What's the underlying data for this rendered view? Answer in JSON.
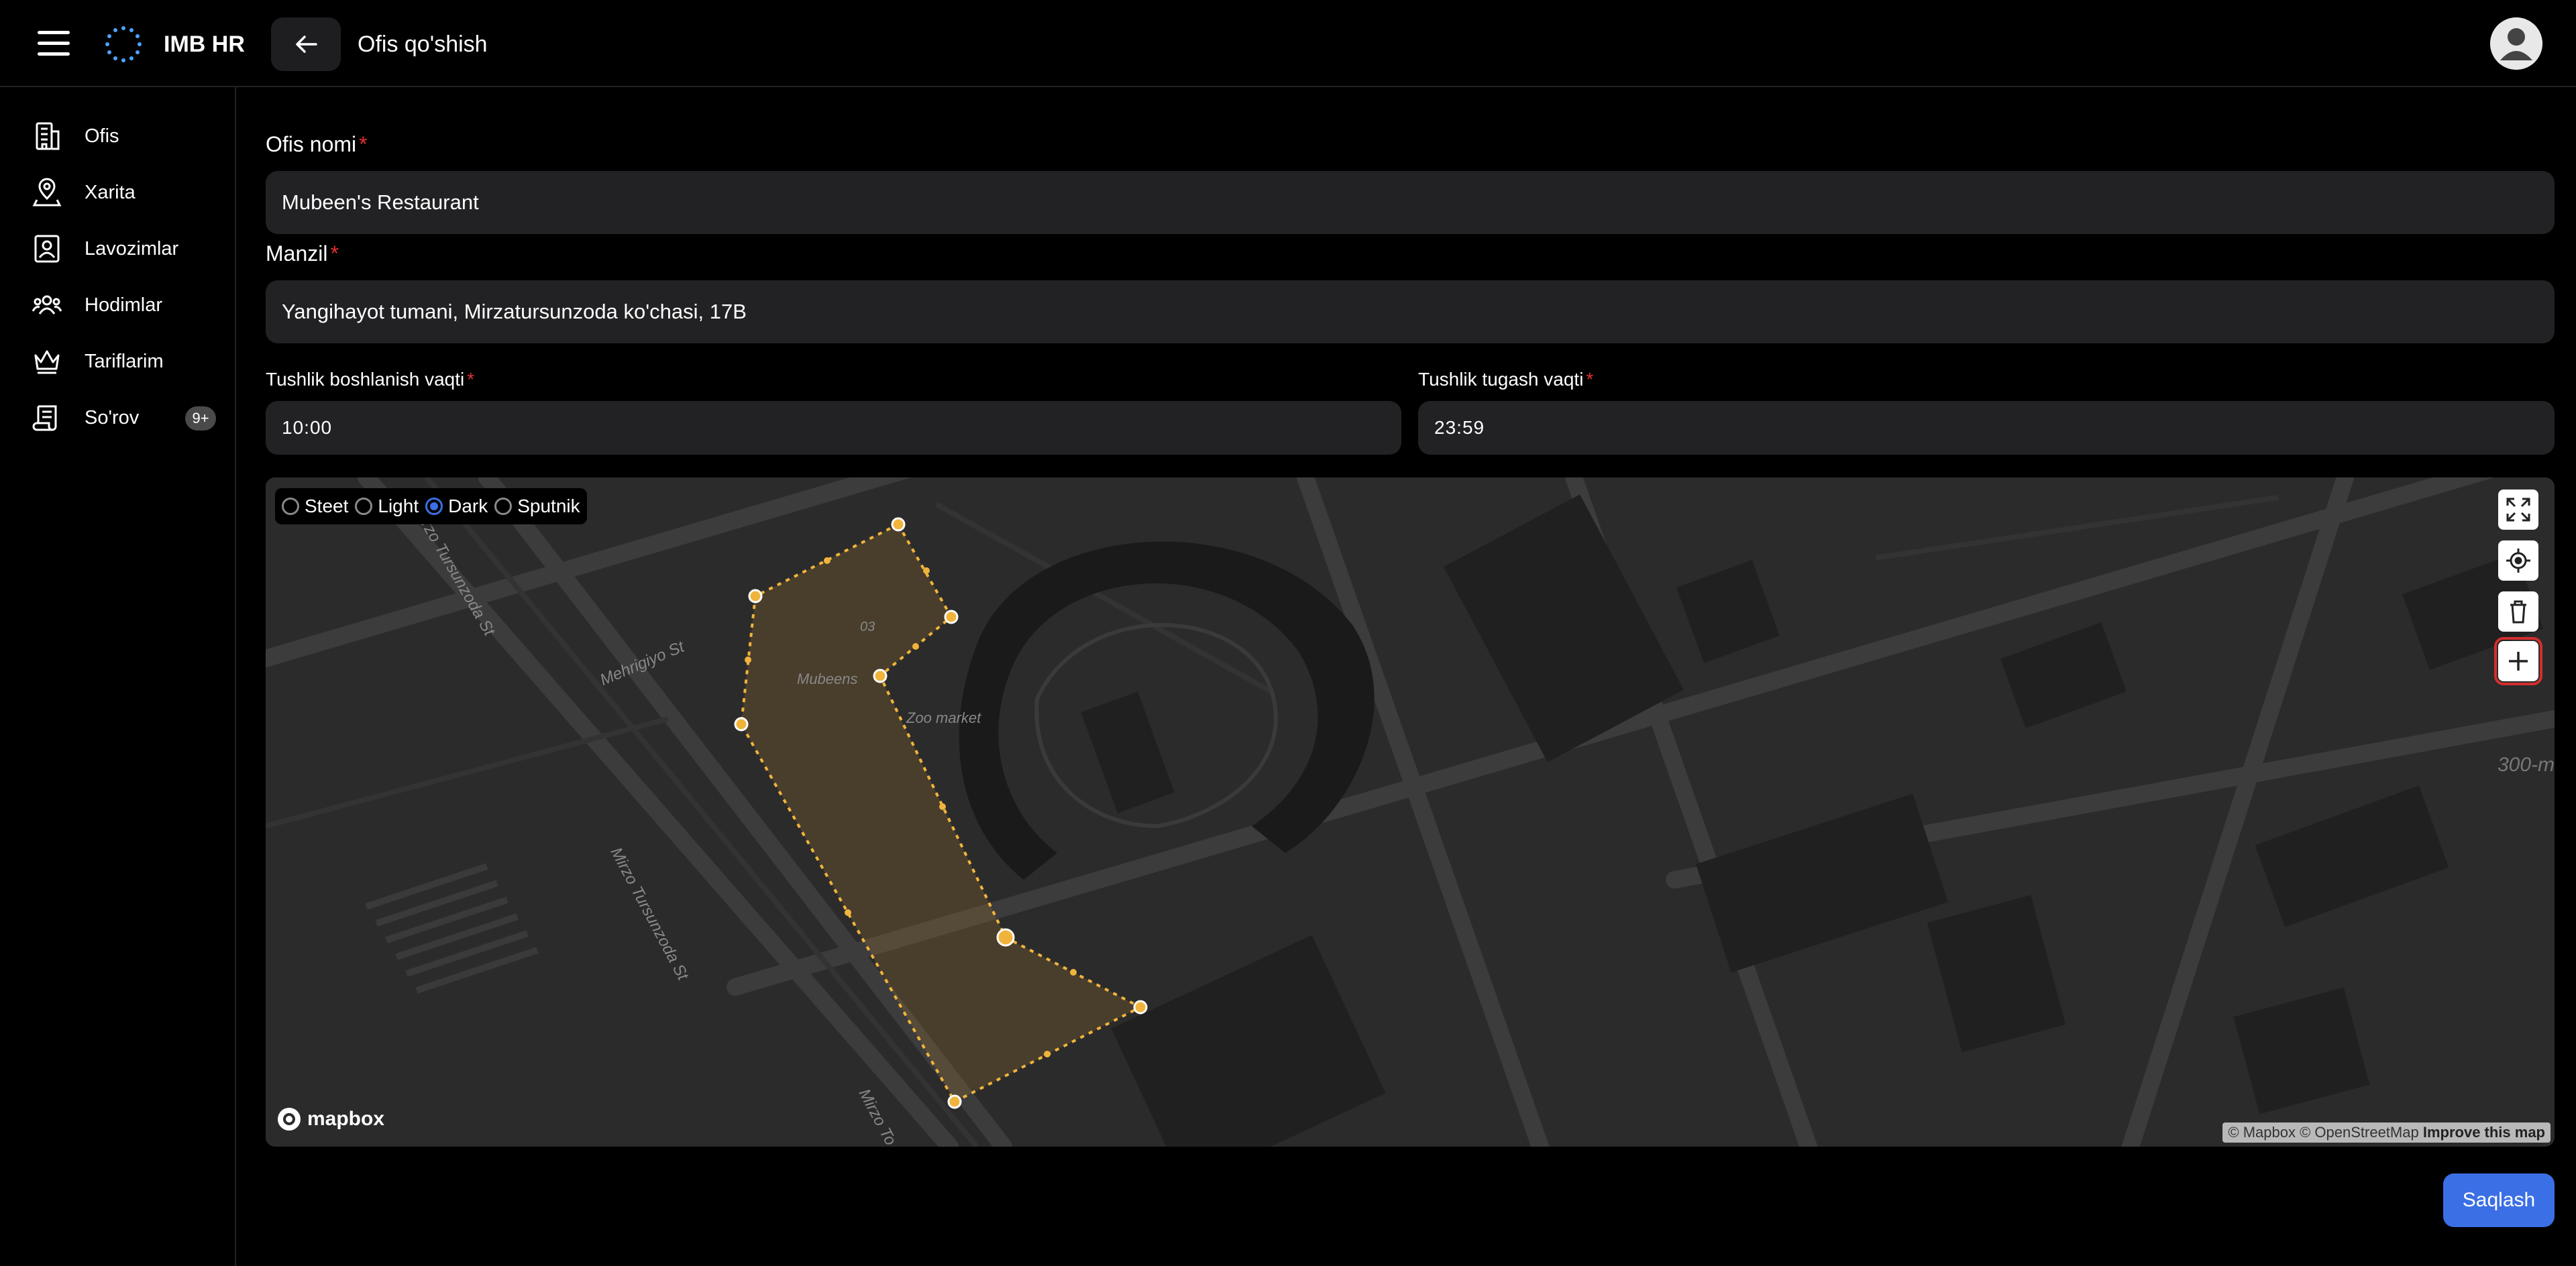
{
  "app": {
    "title": "IMB HR",
    "page_title": "Ofis qo'shish"
  },
  "sidebar": {
    "items": [
      {
        "label": "Ofis",
        "icon": "building-icon"
      },
      {
        "label": "Xarita",
        "icon": "map-pin-icon"
      },
      {
        "label": "Lavozimlar",
        "icon": "id-card-icon"
      },
      {
        "label": "Hodimlar",
        "icon": "users-icon"
      },
      {
        "label": "Tariflarim",
        "icon": "crown-icon"
      },
      {
        "label": "So'rov",
        "icon": "scroll-icon",
        "badge": "9+"
      }
    ]
  },
  "form": {
    "office_name_label": "Ofis nomi",
    "office_name_value": "Mubeen's Restaurant",
    "address_label": "Manzil",
    "address_value": "Yangihayot tumani, Mirzatursunzoda ko'chasi, 17B",
    "lunch_start_label": "Tushlik boshlanish vaqti",
    "lunch_start_hour": "10",
    "lunch_start_min": "00",
    "lunch_end_label": "Tushlik tugash vaqti",
    "lunch_end_hour": "23",
    "lunch_end_min": "59",
    "required_mark": "*",
    "time_sep": ":"
  },
  "map": {
    "styles": [
      {
        "label": "Steet",
        "selected": false
      },
      {
        "label": "Light",
        "selected": false
      },
      {
        "label": "Dark",
        "selected": true
      },
      {
        "label": "Sputnik",
        "selected": false
      }
    ],
    "labels": {
      "mehrigiyo": "Mehrigiyo St",
      "tursunzoda_top": "Mirzo Tursunzoda St",
      "mirzo_tursunzoda": "Mirzo Tursunzoda St",
      "mirzo_to": "Mirzo To",
      "mubeens": "Mubeens",
      "market": "Zoo market",
      "num_03": "03",
      "scale": "300-m"
    },
    "logo_text": "mapbox",
    "attribution": "© Mapbox © OpenStreetMap",
    "improve": "Improve this map",
    "polygon_color": "#f0b43c"
  },
  "actions": {
    "save": "Saqlash"
  },
  "colors": {
    "accent": "#3b6fe5",
    "required": "#e03131"
  }
}
